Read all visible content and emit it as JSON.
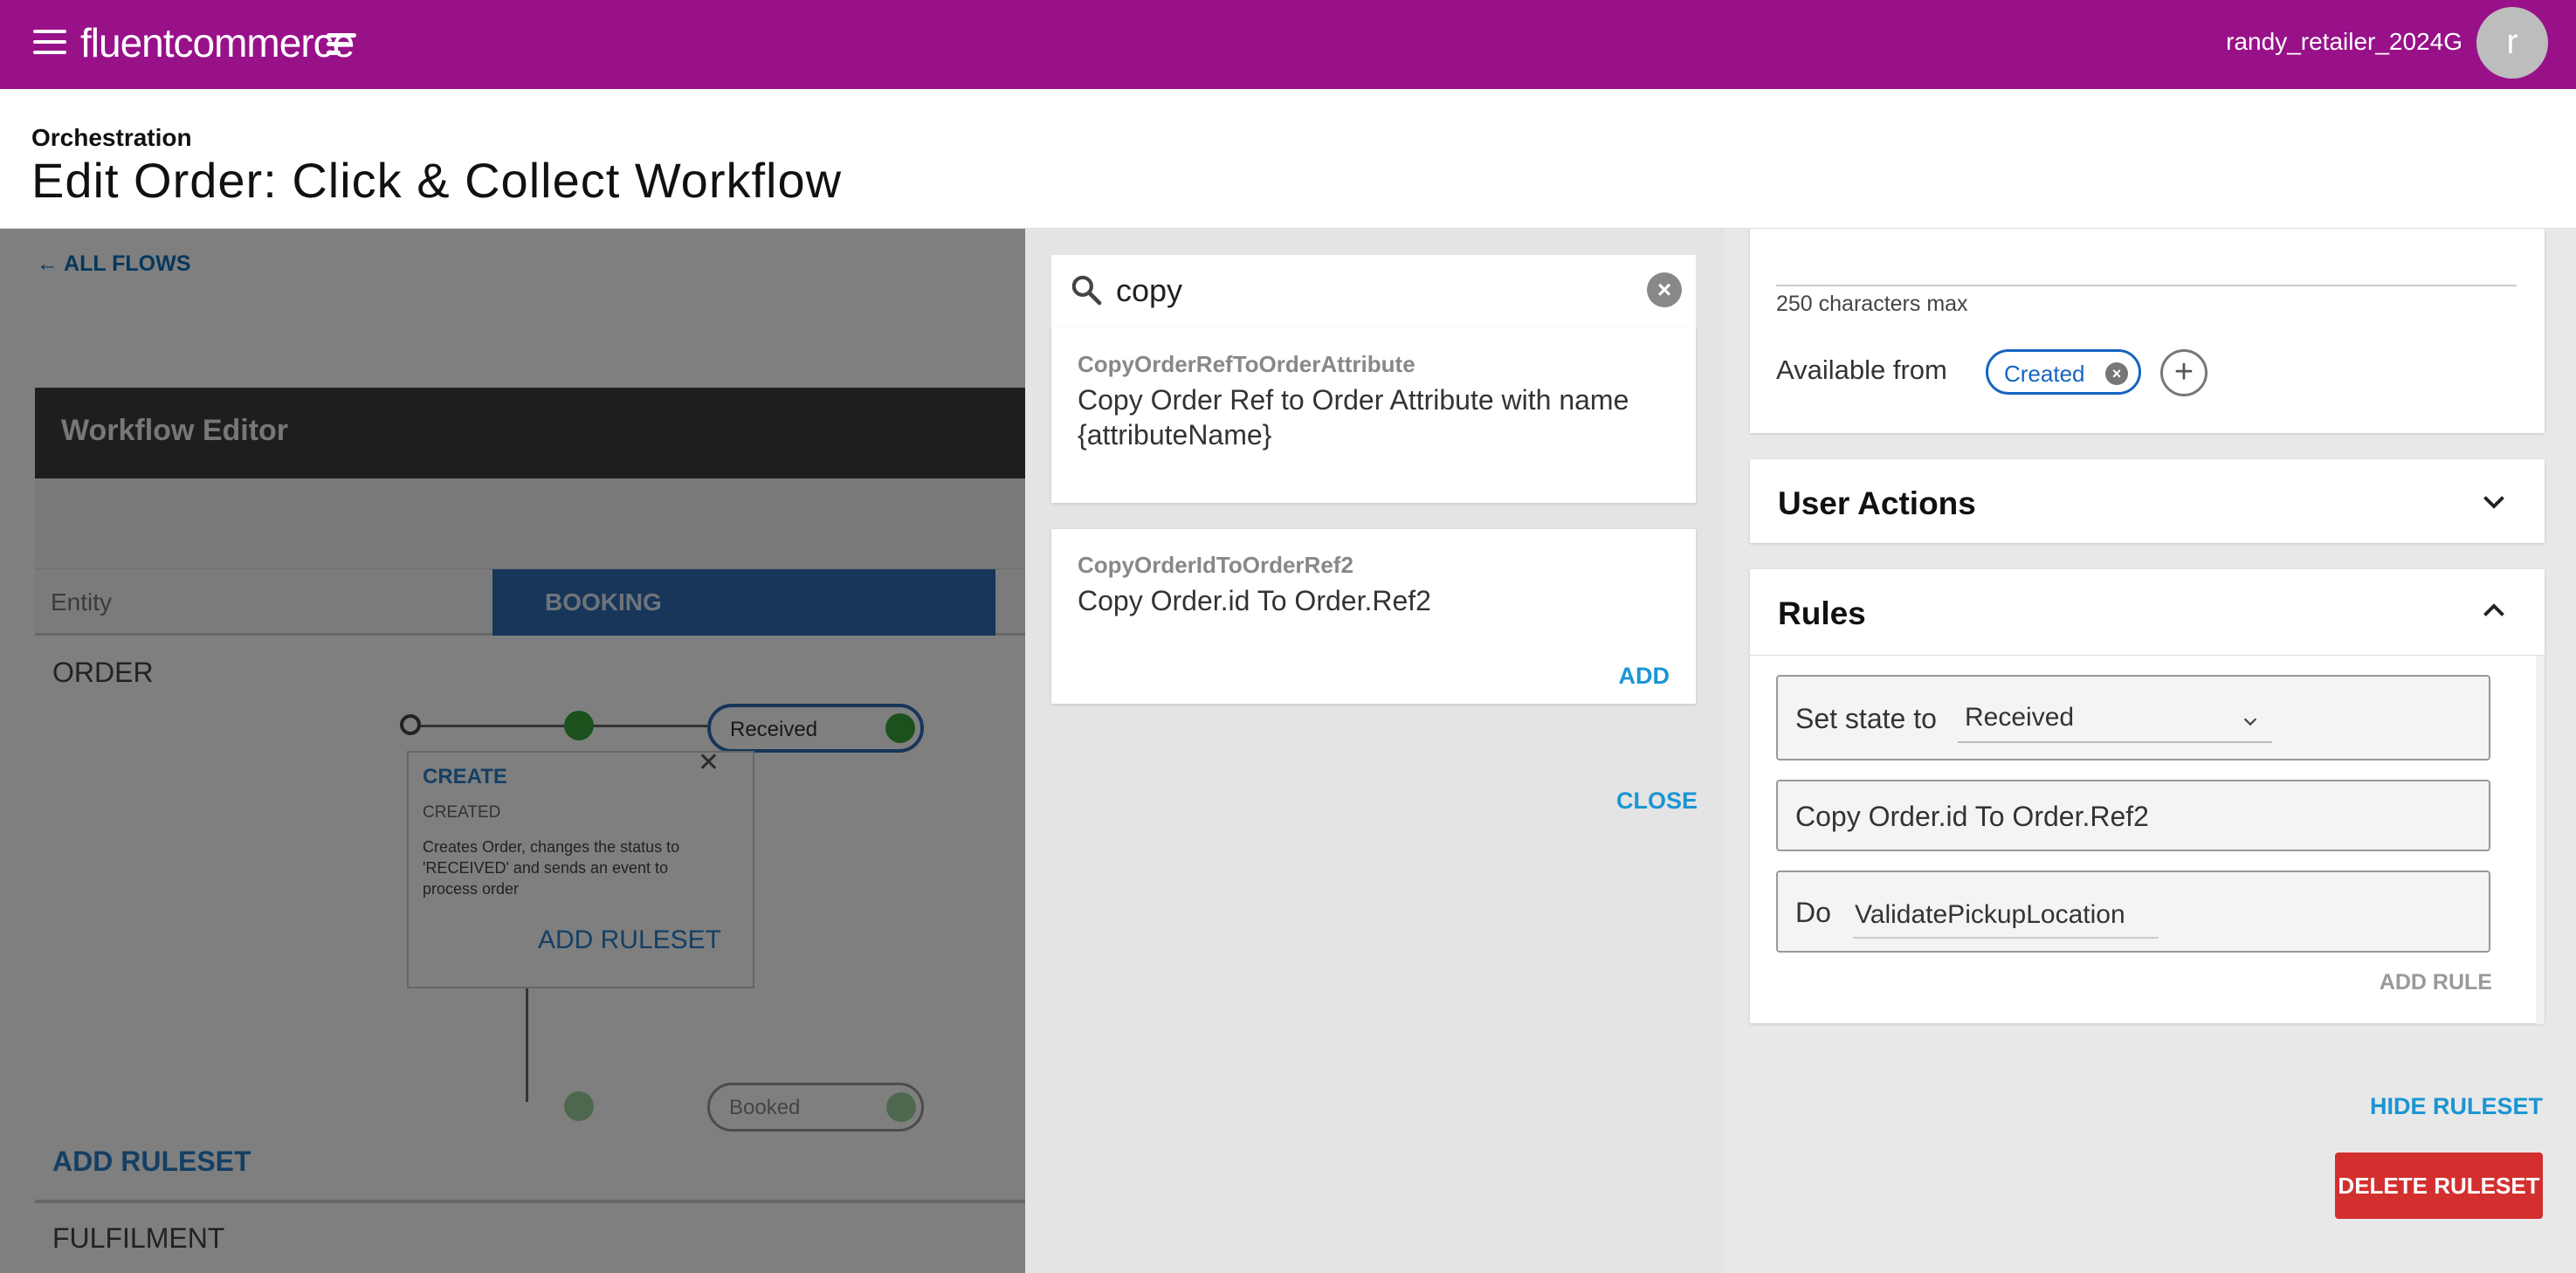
{
  "topbar": {
    "logo_text": "fluentcommerce",
    "username": "randy_retailer_2024G",
    "avatar_initial": "r",
    "brand_color": "#981189"
  },
  "header": {
    "breadcrumb": "Orchestration",
    "title": "Edit Order: Click & Collect Workflow"
  },
  "background": {
    "all_flows": "← ALL FLOWS",
    "editor_title": "Workflow Editor",
    "entity_label": "Entity",
    "booking_label": "BOOKING",
    "order_label": "ORDER",
    "received_state": "Received",
    "booked_state": "Booked",
    "ruleset_card": {
      "title": "CREATE",
      "state": "CREATED",
      "description": "Creates Order, changes the status to 'RECEIVED' and sends an event to process order",
      "add_ruleset": "ADD RULESET"
    },
    "add_ruleset": "ADD RULESET",
    "fulfilment_label": "FULFILMENT"
  },
  "search_panel": {
    "query": "copy",
    "results": [
      {
        "id": "CopyOrderRefToOrderAttribute",
        "name": "Copy Order Ref to Order Attribute with name {attributeName}"
      },
      {
        "id": "CopyOrderIdToOrderRef2",
        "name": "Copy Order.id To Order.Ref2",
        "add_label": "ADD"
      }
    ],
    "close_label": "CLOSE"
  },
  "ruleset_panel": {
    "char_limit": "250 characters max",
    "available_from_label": "Available from",
    "available_from_state": "Created",
    "user_actions_title": "User Actions",
    "rules_title": "Rules",
    "rules": {
      "set_state_label": "Set state to",
      "set_state_value": "Received",
      "copy_rule": "Copy Order.id To Order.Ref2",
      "do_label": "Do",
      "do_value": "ValidatePickupLocation"
    },
    "add_rule_label": "ADD RULE",
    "hide_ruleset_label": "HIDE RULESET",
    "delete_ruleset_label": "DELETE RULESET"
  }
}
